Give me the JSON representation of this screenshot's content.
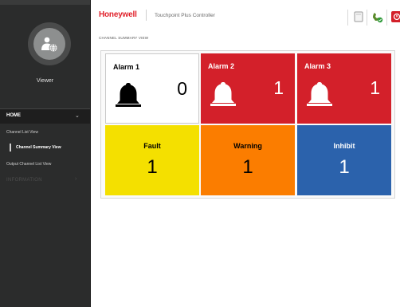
{
  "sidebar": {
    "user_role": "Viewer",
    "nav_home": "HOME",
    "nav_items": [
      {
        "label": "Channel List View"
      },
      {
        "label": "Channel Summary View"
      },
      {
        "label": "Output Channel List View"
      }
    ],
    "nav_information": "INFORMATION"
  },
  "header": {
    "brand": "Honeywell",
    "app_title": "Touchpoint Plus Controller"
  },
  "main": {
    "section_title": "CHANNEL SUMMARY VIEW",
    "tiles": [
      {
        "name": "Alarm 1",
        "value": "0",
        "bg": "#ffffff",
        "fg": "#000000"
      },
      {
        "name": "Alarm 2",
        "value": "1",
        "bg": "#d3202a",
        "fg": "#ffffff"
      },
      {
        "name": "Alarm 3",
        "value": "1",
        "bg": "#d3202a",
        "fg": "#ffffff"
      },
      {
        "name": "Fault",
        "value": "1",
        "bg": "#f4e000",
        "fg": "#000000"
      },
      {
        "name": "Warning",
        "value": "1",
        "bg": "#fb7d00",
        "fg": "#000000"
      },
      {
        "name": "Inhibit",
        "value": "1",
        "bg": "#2b62ac",
        "fg": "#ffffff"
      }
    ]
  },
  "colors": {
    "sidebar_bg": "#2b2c2c",
    "brand_red": "#e0202a",
    "alarm_red": "#d3202a",
    "fault_yellow": "#f4e000",
    "warning_orange": "#fb7d00",
    "inhibit_blue": "#2b62ac"
  }
}
